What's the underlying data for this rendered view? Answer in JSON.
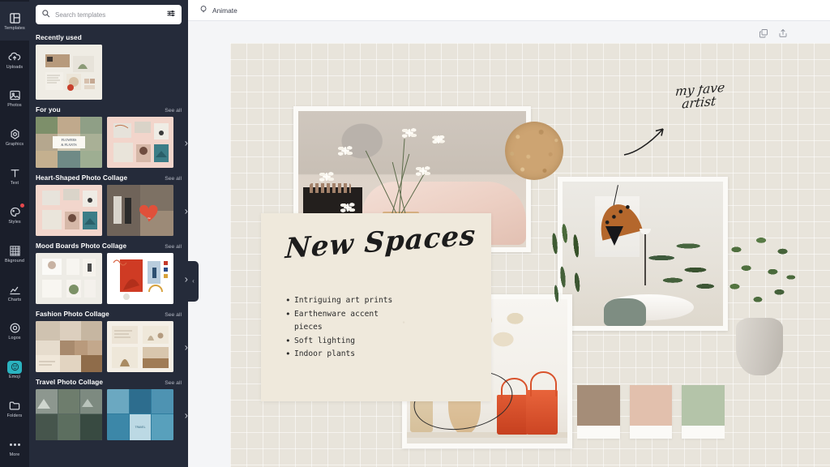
{
  "app": {
    "rail": {
      "items": [
        {
          "label": "Templates",
          "icon": "templates-icon",
          "active": true,
          "badge": false
        },
        {
          "label": "Uploads",
          "icon": "upload-cloud-icon",
          "active": false,
          "badge": false
        },
        {
          "label": "Photos",
          "icon": "photo-icon",
          "active": false,
          "badge": false
        },
        {
          "label": "Graphics",
          "icon": "graphics-shape-icon",
          "active": false,
          "badge": false
        },
        {
          "label": "Text",
          "icon": "text-t-icon",
          "active": false,
          "badge": false
        },
        {
          "label": "Styles",
          "icon": "styles-palette-icon",
          "active": false,
          "badge": true
        },
        {
          "label": "Bkground",
          "icon": "background-grid-icon",
          "active": false,
          "badge": false
        },
        {
          "label": "Charts",
          "icon": "chart-line-icon",
          "active": false,
          "badge": false
        },
        {
          "label": "Logos",
          "icon": "logo-circle-icon",
          "active": false,
          "badge": false
        },
        {
          "label": "Emoji",
          "icon": "emoji-icon",
          "active": false,
          "badge": false,
          "selected": true
        },
        {
          "label": "Folders",
          "icon": "folder-icon",
          "active": false,
          "badge": false
        },
        {
          "label": "More",
          "icon": "more-dots-icon",
          "active": false,
          "badge": false
        }
      ]
    },
    "panel": {
      "search": {
        "placeholder": "Search templates",
        "value": ""
      },
      "sections": [
        {
          "title": "Recently used",
          "see_all": "",
          "has_see_all": false
        },
        {
          "title": "For you",
          "see_all": "See all",
          "has_see_all": true
        },
        {
          "title": "Heart-Shaped Photo Collage",
          "see_all": "See all",
          "has_see_all": true
        },
        {
          "title": "Mood Boards Photo Collage",
          "see_all": "See all",
          "has_see_all": true
        },
        {
          "title": "Fashion Photo Collage",
          "see_all": "See all",
          "has_see_all": true
        },
        {
          "title": "Travel Photo Collage",
          "see_all": "See all",
          "has_see_all": true
        }
      ],
      "collapse_handle": "‹",
      "next_arrow": "›"
    },
    "topbar": {
      "animate_label": "Animate"
    },
    "stage_tools": [
      {
        "name": "duplicate-icon"
      },
      {
        "name": "share-export-icon"
      }
    ]
  },
  "canvas": {
    "title": "New Spaces",
    "note": {
      "line1": "my fave",
      "line2": "artist"
    },
    "bullets": [
      "Intriguing art prints",
      "Earthenware accent pieces",
      "Soft lighting",
      "Indoor plants"
    ],
    "swatches": [
      {
        "name": "taupe-swatch",
        "hex": "#a58d78"
      },
      {
        "name": "blush-swatch",
        "hex": "#e2c0ad"
      },
      {
        "name": "sage-swatch",
        "hex": "#b4c4a9"
      }
    ],
    "background_hex": "#e8e4db"
  }
}
